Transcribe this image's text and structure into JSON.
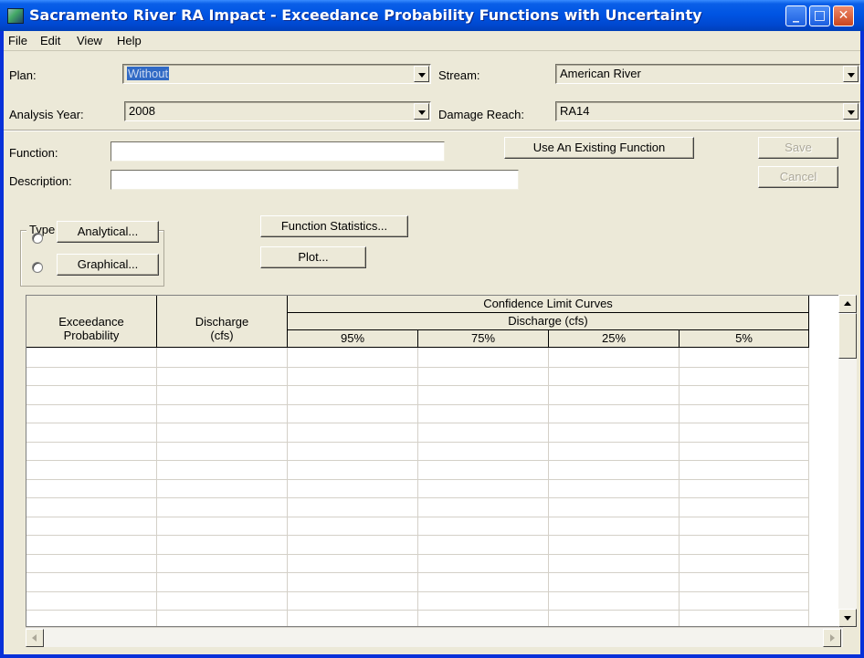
{
  "window": {
    "title": "Sacramento River RA Impact - Exceedance Probability Functions with Uncertainty",
    "minimize": "_",
    "maximize": "□",
    "close": "✕"
  },
  "menu": {
    "file": "File",
    "edit": "Edit",
    "view": "View",
    "help": "Help"
  },
  "selectors": {
    "plan_label": "Plan:",
    "plan_value": "Without",
    "stream_label": "Stream:",
    "stream_value": "American River",
    "year_label": "Analysis Year:",
    "year_value": "2008",
    "reach_label": "Damage Reach:",
    "reach_value": "RA14"
  },
  "form": {
    "function_label": "Function:",
    "function_value": "",
    "description_label": "Description:",
    "description_value": "",
    "use_existing": "Use An Existing Function",
    "save": "Save",
    "cancel": "Cancel",
    "type_legend": "Type",
    "analytical": "Analytical...",
    "graphical": "Graphical...",
    "function_statistics": "Function Statistics...",
    "plot": "Plot..."
  },
  "grid": {
    "col_exceedance": "Exceedance",
    "col_probability": "Probability",
    "col_discharge": "Discharge",
    "col_discharge_unit": "(cfs)",
    "group_title": "Confidence Limit Curves",
    "group_subtitle": "Discharge (cfs)",
    "limits": [
      "95%",
      "75%",
      "25%",
      "5%"
    ]
  }
}
